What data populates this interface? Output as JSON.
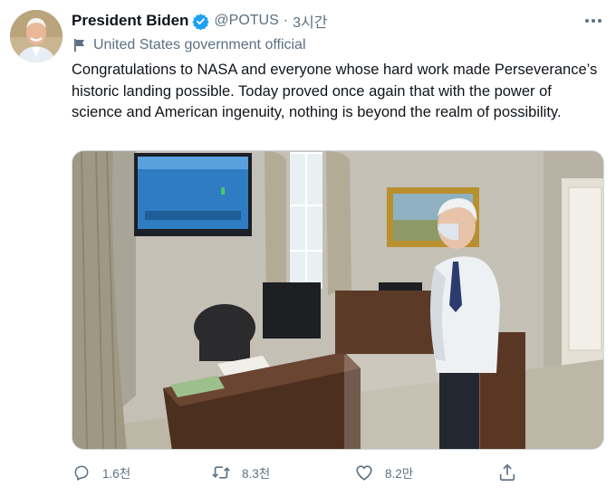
{
  "tweet": {
    "author_name": "President Biden",
    "handle": "@POTUS",
    "separator": "·",
    "time": "3시간",
    "label": "United States government official",
    "text": "Congratulations to NASA and everyone whose hard work made Perseverance’s historic landing possible. Today proved once again that with the power of science and American ingenuity, nothing is beyond the realm of possibility.",
    "accent_color": "#1da1f2",
    "muted_color": "#5b7083"
  },
  "actions": {
    "reply_count": "1.6천",
    "retweet_count": "8.3천",
    "like_count": "8.2만",
    "icons": [
      "reply-icon",
      "retweet-icon",
      "like-icon",
      "share-icon"
    ]
  }
}
